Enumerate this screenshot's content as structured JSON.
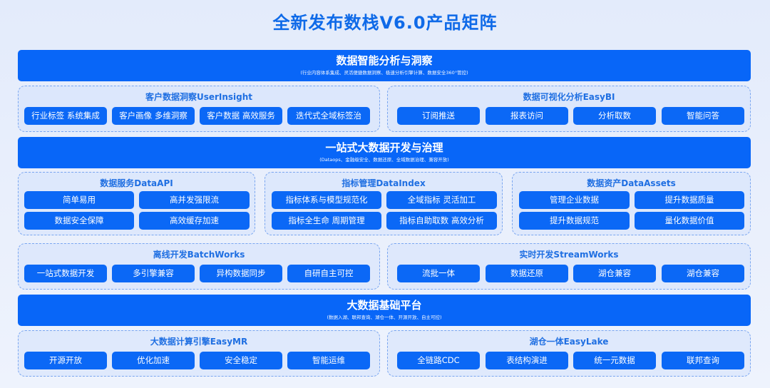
{
  "title": "全新发布数栈V6.0产品矩阵",
  "bands": [
    {
      "title": "数据智能分析与洞察",
      "subtitle": "(行业内容体系集成、灵活便捷数据洞察、极速分析引擎计算、数据安全360°管控)"
    },
    {
      "title": "一站式大数据开发与治理",
      "subtitle": "(Dataops、金融级安全、数据还原、全域数据治理、兼容开放)"
    },
    {
      "title": "大数据基础平台",
      "subtitle": "(数据入湖、联邦查询、湖仓一体、开源开放、自主可控)"
    }
  ],
  "groups": {
    "userinsight": {
      "title": "客户数据洞察UserInsight",
      "items": [
        "行业标签  系统集成",
        "客户画像  多维洞察",
        "客户数据  高效服务",
        "迭代式全域标签治"
      ]
    },
    "easybi": {
      "title": "数据可视化分析EasyBI",
      "items": [
        "订阅推送",
        "报表访问",
        "分析取数",
        "智能问答"
      ]
    },
    "dataapi": {
      "title": "数据服务DataAPI",
      "items": [
        "简单易用",
        "高并发强限流",
        "数据安全保障",
        "高效缓存加速"
      ]
    },
    "dataindex": {
      "title": "指标管理DataIndex",
      "items": [
        "指标体系与模型规范化",
        "全域指标  灵活加工",
        "指标全生命  周期管理",
        "指标自助取数 高效分析"
      ]
    },
    "dataassets": {
      "title": "数据资产DataAssets",
      "items": [
        "管理企业数据",
        "提升数据质量",
        "提升数据规范",
        "量化数据价值"
      ]
    },
    "batchworks": {
      "title": "离线开发BatchWorks",
      "items": [
        "一站式数据开发",
        "多引擎兼容",
        "异构数据同步",
        "自研自主可控"
      ]
    },
    "streamworks": {
      "title": "实时开发StreamWorks",
      "items": [
        "流批一体",
        "数据还原",
        "湖仓兼容",
        "湖仓兼容"
      ]
    },
    "easymr": {
      "title": "大数据计算引擎EasyMR",
      "items": [
        "开源开放",
        "优化加速",
        "安全稳定",
        "智能运维"
      ]
    },
    "easylake": {
      "title": "湖仓一体EasyLake",
      "items": [
        "全链路CDC",
        "表结构演进",
        "统一元数据",
        "联邦查询"
      ]
    }
  }
}
